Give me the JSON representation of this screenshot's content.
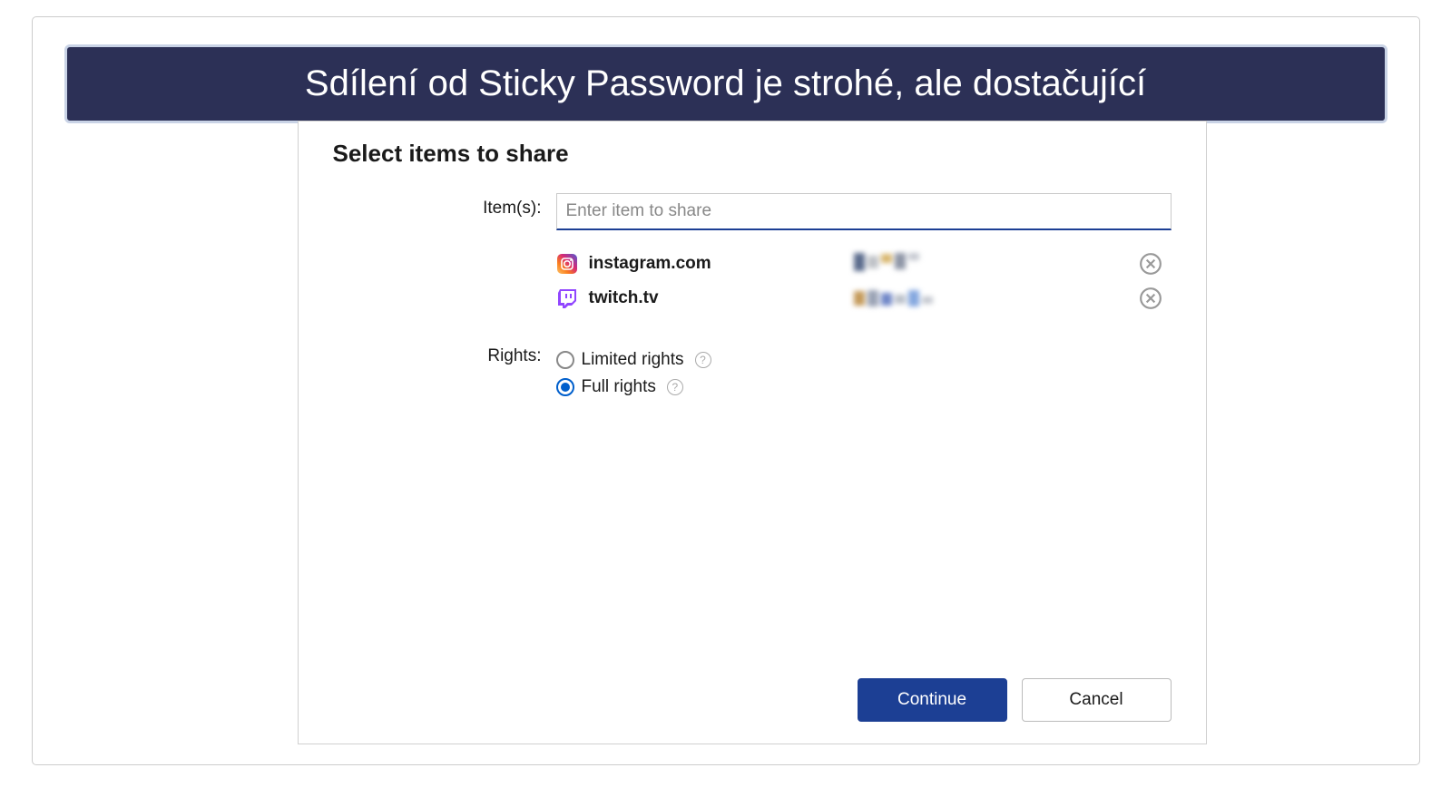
{
  "banner": {
    "text": "Sdílení od Sticky Password je strohé, ale dostačující"
  },
  "dialog": {
    "title": "Select items to share",
    "labels": {
      "items": "Item(s):",
      "rights": "Rights:"
    },
    "input": {
      "placeholder": "Enter item to share",
      "value": ""
    },
    "items": [
      {
        "icon": "instagram-icon",
        "name": "instagram.com"
      },
      {
        "icon": "twitch-icon",
        "name": "twitch.tv"
      }
    ],
    "rights": {
      "options": [
        {
          "label": "Limited rights",
          "selected": false
        },
        {
          "label": "Full rights",
          "selected": true
        }
      ]
    },
    "buttons": {
      "continue": "Continue",
      "cancel": "Cancel"
    }
  }
}
